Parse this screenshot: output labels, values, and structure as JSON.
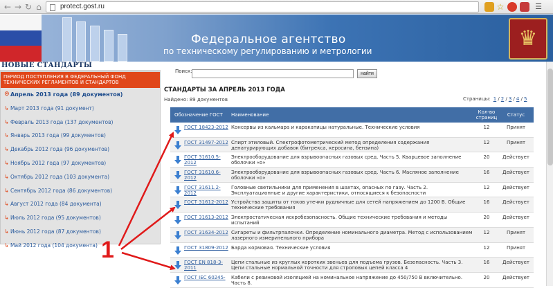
{
  "browser": {
    "url": "protect.gost.ru",
    "icons": [
      "back-icon",
      "forward-icon",
      "reload-icon",
      "home-icon",
      "star-icon"
    ]
  },
  "header": {
    "line1": "Федеральное агентство",
    "line2": "по техническому регулированию и метрологии"
  },
  "sidebar": {
    "title": "НОВЫЕ СТАНДАРТЫ",
    "period_header": "ПЕРИОД ПОСТУПЛЕНИЯ В ФЕДЕРАЛЬНЫЙ ФОНД ТЕХНИЧЕСКИХ РЕГЛАМЕНТОВ И СТАНДАРТОВ",
    "items": [
      {
        "label": "Апрель 2013 года (89 документов)",
        "active": true
      },
      {
        "label": "Март 2013 года (91 документ)"
      },
      {
        "label": "Февраль 2013 года (137 документов)"
      },
      {
        "label": "Январь 2013 года (99 документов)"
      },
      {
        "label": "Декабрь 2012 года (96 документов)"
      },
      {
        "label": "Ноябрь 2012 года (97 документов)"
      },
      {
        "label": "Октябрь 2012 года (103 документа)"
      },
      {
        "label": "Сентябрь 2012 года (86 документов)"
      },
      {
        "label": "Август 2012 года (84 документа)"
      },
      {
        "label": "Июль 2012 года (95 документов)"
      },
      {
        "label": "Июнь 2012 года (87 документов)"
      },
      {
        "label": "Май 2012 года (104 документа)"
      }
    ]
  },
  "search": {
    "label": "Поиск:",
    "value": "",
    "button": "найти"
  },
  "main": {
    "title": "СТАНДАРТЫ ЗА АПРЕЛЬ 2013 ГОДА",
    "found": "Найдено: 89 документов",
    "pages_label": "Страницы:",
    "pages": [
      "1",
      "2",
      "3",
      "4",
      "5"
    ]
  },
  "table": {
    "headers": {
      "code": "Обозначение ГОСТ",
      "title": "Наименование",
      "pages": "Кол-во страниц",
      "status": "Статус"
    },
    "rows": [
      {
        "code": "ГОСТ 18423-2012",
        "title": "Консервы из кальмара и каракатицы натуральные. Технические условия",
        "pages": "12",
        "status": "Принят"
      },
      {
        "code": "ГОСТ 31497-2012",
        "title": "Спирт этиловый. Спектрофотометрический метод определения содержания денатурирующих добавок (битрекса, керосина, бензина)",
        "pages": "12",
        "status": "Принят"
      },
      {
        "code": "ГОСТ 31610.5-2012",
        "title": "Электрооборудование для взрывоопасных газовых сред. Часть 5. Кварцевое заполнение оболочки «о»",
        "pages": "20",
        "status": "Действует"
      },
      {
        "code": "ГОСТ 31610.6-2012",
        "title": "Электрооборудование для взрывоопасных газовых сред. Часть 6. Масляное заполнение оболочки «о»",
        "pages": "16",
        "status": "Действует"
      },
      {
        "code": "ГОСТ 31611.2-2012",
        "title": "Головные светильники для применения в шахтах, опасных по газу. Часть 2. Эксплуатационные и другие характеристики, относящиеся к безопасности",
        "pages": "12",
        "status": "Действует"
      },
      {
        "code": "ГОСТ 31612-2012",
        "title": "Устройства защиты от токов утечки рудничные для сетей напряжением до 1200 В. Общие технические требования",
        "pages": "16",
        "status": "Действует"
      },
      {
        "code": "ГОСТ 31613-2012",
        "title": "Электростатическая искробезопасность. Общие технические требования и методы испытаний",
        "pages": "20",
        "status": "Действует"
      },
      {
        "code": "ГОСТ 31634-2012",
        "title": "Сигареты и фильтрпалочки. Определение номинального диаметра. Метод с использованием лазерного измерительного прибора",
        "pages": "12",
        "status": "Принят"
      },
      {
        "code": "ГОСТ 31809-2012",
        "title": "Барда кормовая. Технические условия",
        "pages": "12",
        "status": "Принят"
      },
      {
        "code": "ГОСТ EN 818-3-2011",
        "title": "Цепи стальные из круглых коротких звеньев для подъема грузов. Безопасность. Часть 3. Цепи стальные нормальной точности для строповых цепей класса 4",
        "pages": "16",
        "status": "Действует"
      },
      {
        "code": "ГОСТ IEC 60245-",
        "title": "Кабели с резиновой изоляцией на номинальное напряжение до 450/750 В включительно. Часть 8.",
        "pages": "20",
        "status": "Действует"
      }
    ]
  },
  "annotation": {
    "label": "1",
    "color": "#e01a1a"
  },
  "colors": {
    "table_header": "#416ea6",
    "period_header": "#e0471a",
    "link": "#2c5c9e"
  }
}
